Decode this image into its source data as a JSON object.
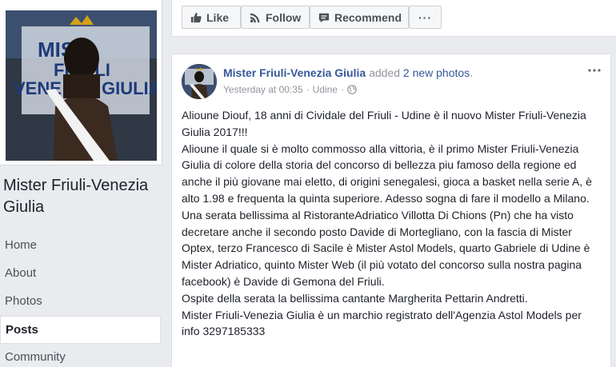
{
  "page": {
    "name": "Mister Friuli-Venezia Giulia"
  },
  "nav": {
    "items": [
      {
        "label": "Home"
      },
      {
        "label": "About"
      },
      {
        "label": "Photos"
      },
      {
        "label": "Posts"
      },
      {
        "label": "Community"
      }
    ],
    "active": "Posts"
  },
  "actions": {
    "like": "Like",
    "follow": "Follow",
    "recommend": "Recommend",
    "more": "···"
  },
  "post": {
    "author": "Mister Friuli-Venezia Giulia",
    "verb": "added",
    "count": "2 new photos",
    "period": ".",
    "time": "Yesterday at 00:35",
    "separator": "·",
    "location": "Udine",
    "separator2": "·",
    "paragraphs": [
      "Alioune Diouf, 18 anni di Cividale del Friuli - Udine è il nuovo Mister Friuli-Venezia Giulia 2017!!!",
      "Alioune il quale si è molto commosso alla vittoria, è il primo Mister Friuli-Venezia Giulia di colore della storia del concorso di bellezza piu famoso della regione ed anche il più giovane mai eletto, di origini senegalesi, gioca a basket nella serie A, è alto 1.98 e frequenta la quinta superiore. Adesso sogna di fare il modello a Milano.",
      "Una serata bellissima al RistoranteAdriatico Villotta Di Chions (Pn) che ha visto decretare anche il secondo posto Davide di Mortegliano, con la fascia di Mister Optex, terzo Francesco di Sacile è Mister Astol Models, quarto Gabriele di Udine è Mister Adriatico, quinto Mister Web (il più votato del concorso sulla nostra pagina facebook) è Davide di Gemona del Friuli.",
      "Ospite della serata la bellissima cantante Margherita Pettarin Andretti.",
      "Mister Friuli-Venezia Giulia è un marchio registrato dell'Agenzia Astol Models per info 3297185333"
    ]
  },
  "colors": {
    "link": "#365899",
    "background": "#e9ebee",
    "meta": "#90949c"
  }
}
